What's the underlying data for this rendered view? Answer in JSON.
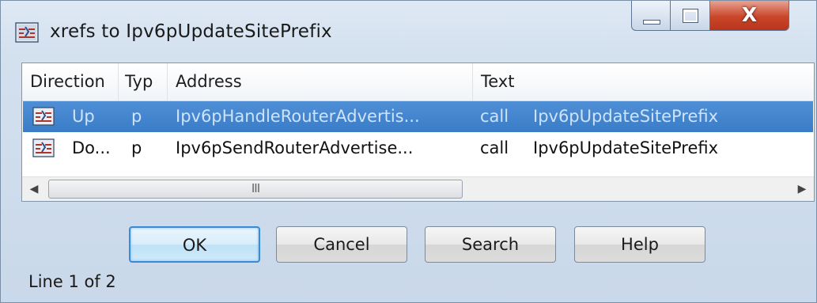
{
  "window": {
    "title": "xrefs to Ipv6pUpdateSitePrefix",
    "icon": "xref-window-icon",
    "controls": {
      "minimize": "minimize-icon",
      "maximize": "maximize-icon",
      "close_glyph": "X"
    }
  },
  "table": {
    "columns": [
      {
        "label": "Direction"
      },
      {
        "label": "Typ"
      },
      {
        "label": "Address"
      },
      {
        "label": "Text"
      }
    ],
    "rows": [
      {
        "direction": "Up",
        "type": "p",
        "address": "Ipv6pHandleRouterAdvertis...",
        "text_op": "call",
        "text_target": "Ipv6pUpdateSitePrefix",
        "selected": true
      },
      {
        "direction": "Do...",
        "type": "p",
        "address": "Ipv6pSendRouterAdvertise...",
        "text_op": "call",
        "text_target": "Ipv6pUpdateSitePrefix",
        "selected": false
      }
    ],
    "scrollbar": {
      "grip": "III",
      "left_arrow": "◀",
      "right_arrow": "▶"
    }
  },
  "buttons": {
    "ok": "OK",
    "cancel": "Cancel",
    "search": "Search",
    "help": "Help"
  },
  "status": "Line 1 of 2",
  "colors": {
    "selection": "#3b7cc8",
    "close_button": "#c9462a",
    "default_button_border": "#3c8ad6"
  }
}
